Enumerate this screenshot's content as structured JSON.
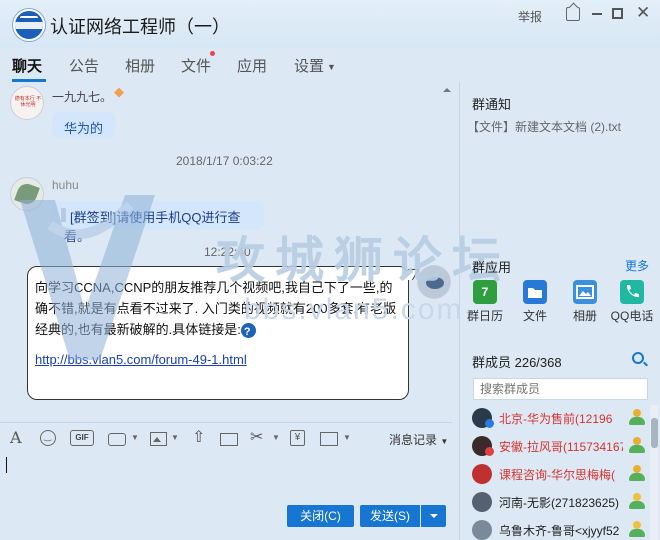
{
  "window": {
    "title": "认证网络工程师（一）",
    "report_label": "举报"
  },
  "tabs": [
    {
      "label": "聊天",
      "active": true
    },
    {
      "label": "公告"
    },
    {
      "label": "相册"
    },
    {
      "label": "文件",
      "has_notification": true
    },
    {
      "label": "应用"
    },
    {
      "label": "设置"
    }
  ],
  "messages": [
    {
      "sender": "一九九七。",
      "text": "华为的"
    },
    {
      "timestamp": "2018/1/17 0:03:22"
    },
    {
      "sender": "huhu",
      "text": "[群签到]请使用手机QQ进行查看。"
    },
    {
      "timestamp": "12:22:40"
    },
    {
      "text": "向学习CCNA,CCNP的朋友推荐几个视频吧,我自己下了一些,的确不错,就是有点看不过来了. 入门类的视频就有200多套,有老版经典的,也有最新破解的.具体链接是:",
      "link": "http://bbs.vlan5.com/forum-49-1.html"
    }
  ],
  "avatar1_text": "德有本行 不休光明",
  "watermark": {
    "text": "攻城狮论坛",
    "url": "bbs.vlan5.com"
  },
  "toolbar": {
    "gif_label": "GIF",
    "history_label": "消息记录"
  },
  "buttons": {
    "close": "关闭(C)",
    "send": "发送(S)"
  },
  "right_panel": {
    "notice_title": "群通知",
    "notice_text": "【文件】新建文本文档 (2).txt",
    "apps_title": "群应用",
    "apps_more": "更多",
    "apps": [
      {
        "label": "群日历",
        "icon_text": "7"
      },
      {
        "label": "文件"
      },
      {
        "label": "相册"
      },
      {
        "label": "QQ电话"
      }
    ],
    "members_title": "群成员 226/368",
    "member_search_placeholder": "搜索群成员",
    "members": [
      {
        "name": "北京-华为售前(12196",
        "color": "#d6332f",
        "role": "admin"
      },
      {
        "name": "安徽-拉风哥(115734167",
        "color": "#d6332f",
        "role": "admin"
      },
      {
        "name": "课程咨询-华尔思梅梅(",
        "color": "#d6332f",
        "role": "admin"
      },
      {
        "name": "河南-无影(271823625)",
        "color": "#222222",
        "role": "member"
      },
      {
        "name": "乌鲁木齐-鲁哥<xjyyf52",
        "color": "#222222",
        "role": "member"
      }
    ]
  },
  "colors": {
    "accent": "#1676d2",
    "admin_name": "#d6332f",
    "bubble": "#d3e6fb"
  }
}
